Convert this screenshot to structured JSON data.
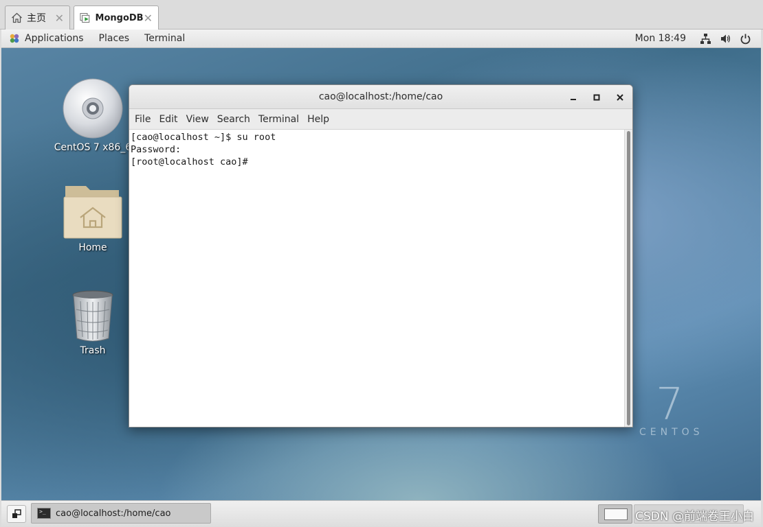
{
  "vm_tabs": {
    "home_label": "主页",
    "active_label": "MongoDB"
  },
  "topbar": {
    "applications": "Applications",
    "places": "Places",
    "terminal": "Terminal",
    "clock": "Mon 18:49"
  },
  "desktop": {
    "icons": [
      {
        "label": "CentOS 7 x86_6",
        "icon": "dvd-icon"
      },
      {
        "label": "Home",
        "icon": "home-folder-icon"
      },
      {
        "label": "Trash",
        "icon": "trash-icon"
      }
    ],
    "brand_number": "7",
    "brand_text": "CENTOS"
  },
  "terminal": {
    "title": "cao@localhost:/home/cao",
    "menu": [
      "File",
      "Edit",
      "View",
      "Search",
      "Terminal",
      "Help"
    ],
    "lines": [
      "[cao@localhost ~]$ su root",
      "Password:",
      "[root@localhost cao]# "
    ]
  },
  "bottombar": {
    "task_label": "cao@localhost:/home/cao",
    "watermark": "CSDN @前端卷王小白"
  },
  "colors": {
    "desktop_accent": "#4f7d9f",
    "panel_bg": "#e6e6e6"
  }
}
